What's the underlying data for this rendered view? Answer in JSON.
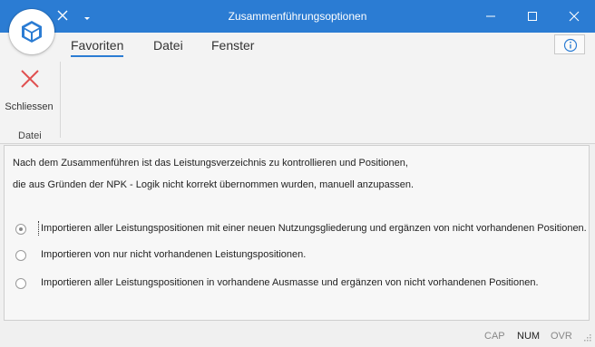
{
  "window": {
    "title": "Zusammenführungsoptionen",
    "accent": "#2b7cd3"
  },
  "quick_access": {
    "close_icon": "close-icon",
    "dropdown_icon": "chevron-down-icon"
  },
  "menu": {
    "tabs": [
      {
        "label": "Favoriten",
        "active": true
      },
      {
        "label": "Datei",
        "active": false
      },
      {
        "label": "Fenster",
        "active": false
      }
    ],
    "info_icon": "info-icon"
  },
  "ribbon": {
    "close_label": "Schliessen",
    "close_icon_color": "#e05050",
    "group_label": "Datei"
  },
  "content": {
    "description_line1": "Nach dem Zusammenführen ist das Leistungsverzeichnis zu kontrollieren und Positionen,",
    "description_line2": "die aus Gründen der NPK - Logik nicht korrekt übernommen wurden, manuell anzupassen.",
    "options": [
      {
        "label": "Importieren aller Leistungspositionen mit einer neuen Nutzungsgliederung und ergänzen von nicht vorhandenen Positionen.",
        "selected": true
      },
      {
        "label": "Importieren von nur nicht vorhandenen Leistungspositionen.",
        "selected": false
      },
      {
        "label": "Importieren aller Leistungspositionen in vorhandene Ausmasse und ergänzen von nicht vorhandenen Positionen.",
        "selected": false
      }
    ]
  },
  "statusbar": {
    "cap": "CAP",
    "num": "NUM",
    "ovr": "OVR"
  }
}
